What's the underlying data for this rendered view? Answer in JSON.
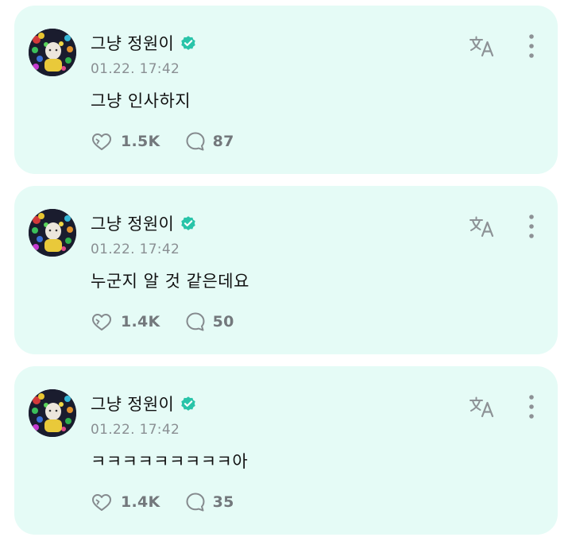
{
  "posts": [
    {
      "author": "그냥 정원이",
      "timestamp": "01.22. 17:42",
      "text": "그냥 인사하지",
      "likes": "1.5K",
      "comments": "87"
    },
    {
      "author": "그냥 정원이",
      "timestamp": "01.22. 17:42",
      "text": "누군지 알 것 같은데요",
      "likes": "1.4K",
      "comments": "50"
    },
    {
      "author": "그냥 정원이",
      "timestamp": "01.22. 17:42",
      "text": "ㅋㅋㅋㅋㅋㅋㅋㅋㅋ아",
      "likes": "1.4K",
      "comments": "35"
    }
  ],
  "icons": {
    "verified": "verified-badge-icon",
    "translate": "translate-icon",
    "more": "more-vertical-icon",
    "like": "like-heart-icon",
    "comment": "comment-bubble-icon"
  },
  "colors": {
    "card_background": "#e5fbf6",
    "verified": "#29c4a9",
    "muted": "#8a8f93",
    "text": "#111111"
  }
}
